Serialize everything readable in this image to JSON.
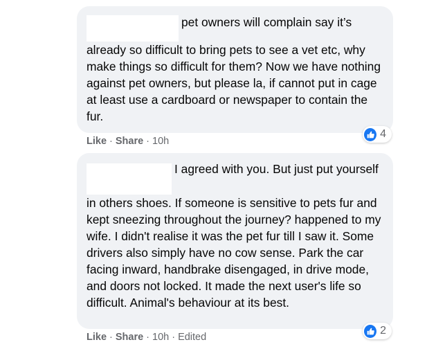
{
  "comments": [
    {
      "text": "pet owners will complain say it’s already so difficult to bring pets to see a vet etc, why make things so difficult for them? Now we have nothing against pet owners, but please la, if cannot put in cage at least use a cardboard or newspaper to contain the fur.",
      "reaction_count": "4",
      "actions": {
        "like": "Like",
        "share": "Share",
        "time": "10h",
        "edited": ""
      }
    },
    {
      "text": "I agreed with you. But just put yourself in others shoes. If someone is sensitive to pets fur and kept sneezing throughout the journey? happened to my wife. I didn't realise it was the pet fur till I saw it. Some drivers also simply have no cow sense. Park the car facing inward, handbrake disengaged, in drive mode, and doors not locked. It made the next user's life so difficult. Animal's behaviour at its best.",
      "reaction_count": "2",
      "actions": {
        "like": "Like",
        "share": "Share",
        "time": "10h",
        "edited": "Edited"
      }
    }
  ],
  "separator": "·",
  "icons": {
    "reaction": "thumbs-up-icon"
  },
  "colors": {
    "bubble": "#f0f2f5",
    "like_blue": "#1877f2",
    "meta_text": "#65676b"
  }
}
